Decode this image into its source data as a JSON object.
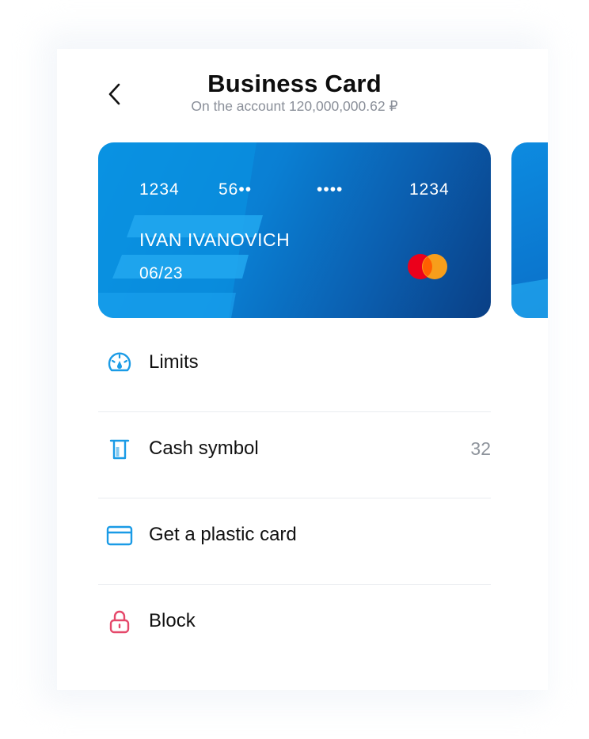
{
  "header": {
    "title": "Business Card",
    "subtitle": "On the account 120,000,000.62 ₽"
  },
  "card": {
    "number_group_1": "1234",
    "number_group_2": "56••",
    "number_group_3": "••••",
    "number_group_4": "1234",
    "holder_name": "IVAN IVANOVICH",
    "expiry": "06/23",
    "brand_icon": "mastercard-logo",
    "colors": {
      "start": "#0a8fe0",
      "end": "#0a3f85"
    }
  },
  "menu": {
    "items": [
      {
        "label": "Limits",
        "icon": "speedometer-icon",
        "badge": ""
      },
      {
        "label": "Cash symbol",
        "icon": "cash-symbol-icon",
        "badge": "32"
      },
      {
        "label": "Get a plastic card",
        "icon": "credit-card-icon",
        "badge": ""
      },
      {
        "label": "Block",
        "icon": "lock-icon",
        "badge": ""
      }
    ]
  },
  "colors": {
    "accent": "#1a9be6",
    "danger": "#e5486a",
    "text_primary": "#111111",
    "text_secondary": "#8a8f99"
  }
}
